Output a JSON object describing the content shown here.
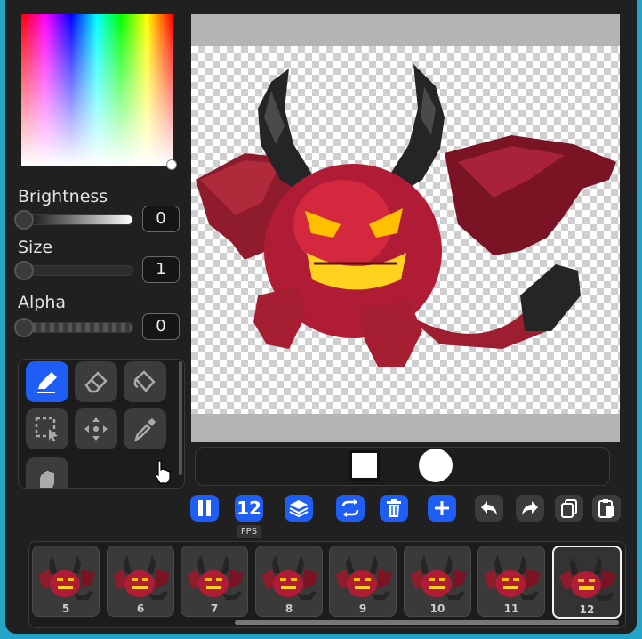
{
  "color_picker": {
    "selected_color": "#ffffff"
  },
  "brightness": {
    "label": "Brightness",
    "value": "0"
  },
  "size": {
    "label": "Size",
    "value": "1"
  },
  "alpha": {
    "label": "Alpha",
    "value": "0"
  },
  "tools": [
    {
      "name": "pencil-tool",
      "icon": "pencil-icon",
      "active": true
    },
    {
      "name": "eraser-tool",
      "icon": "eraser-icon",
      "active": false
    },
    {
      "name": "fill-tool",
      "icon": "paint-bucket-icon",
      "active": false
    },
    {
      "name": "select-tool",
      "icon": "selection-icon",
      "active": false
    },
    {
      "name": "move-tool",
      "icon": "move-arrows-icon",
      "active": false
    },
    {
      "name": "eyedropper-tool",
      "icon": "eyedropper-icon",
      "active": false
    },
    {
      "name": "hand-tool",
      "icon": "hand-icon",
      "active": false
    }
  ],
  "brush_shapes": [
    {
      "name": "square-brush",
      "icon": "square-icon"
    },
    {
      "name": "round-brush",
      "icon": "circle-icon"
    }
  ],
  "controls": {
    "fps_value": "12",
    "fps_label": "FPS"
  },
  "frames": [
    {
      "number": "5"
    },
    {
      "number": "6"
    },
    {
      "number": "7"
    },
    {
      "number": "8"
    },
    {
      "number": "9"
    },
    {
      "number": "10"
    },
    {
      "number": "11"
    },
    {
      "number": "12",
      "selected": true
    }
  ],
  "colors": {
    "accent": "#1e5ef5",
    "panel": "#202020",
    "demon_body": "#b01c36",
    "demon_horn": "#202020",
    "demon_eyes": "#ffc000"
  }
}
